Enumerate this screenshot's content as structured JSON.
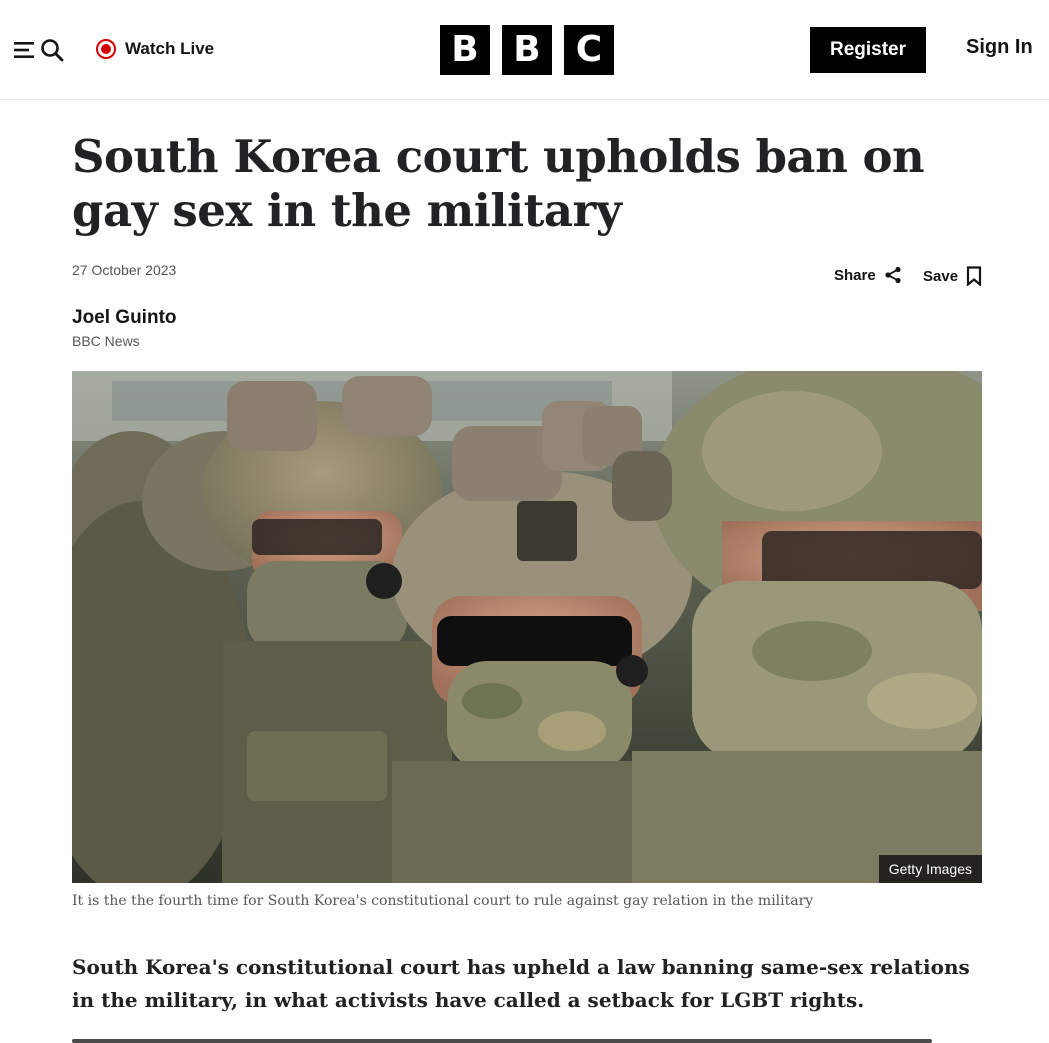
{
  "header": {
    "watch_live_label": "Watch Live",
    "logo_letters": [
      "B",
      "B",
      "C"
    ],
    "register_label": "Register",
    "sign_in_label": "Sign In",
    "live_color": "#d40000"
  },
  "article": {
    "headline": "South Korea court upholds ban on gay sex in the military",
    "date": "27 October 2023",
    "share_label": "Share",
    "save_label": "Save",
    "author": "Joel Guinto",
    "outlet": "BBC News",
    "image_credit": "Getty Images",
    "image_caption": "It is the the fourth time for South Korea's constitutional court to rule against gay relation in the military",
    "lede": "South Korea's constitutional court has upheld a law banning same-sex relations in the military, in what activists have called a setback for LGBT rights."
  },
  "icons": {
    "menu": "menu-icon",
    "search": "search-icon",
    "live": "live-dot-icon",
    "share": "share-icon",
    "save": "bookmark-icon"
  }
}
